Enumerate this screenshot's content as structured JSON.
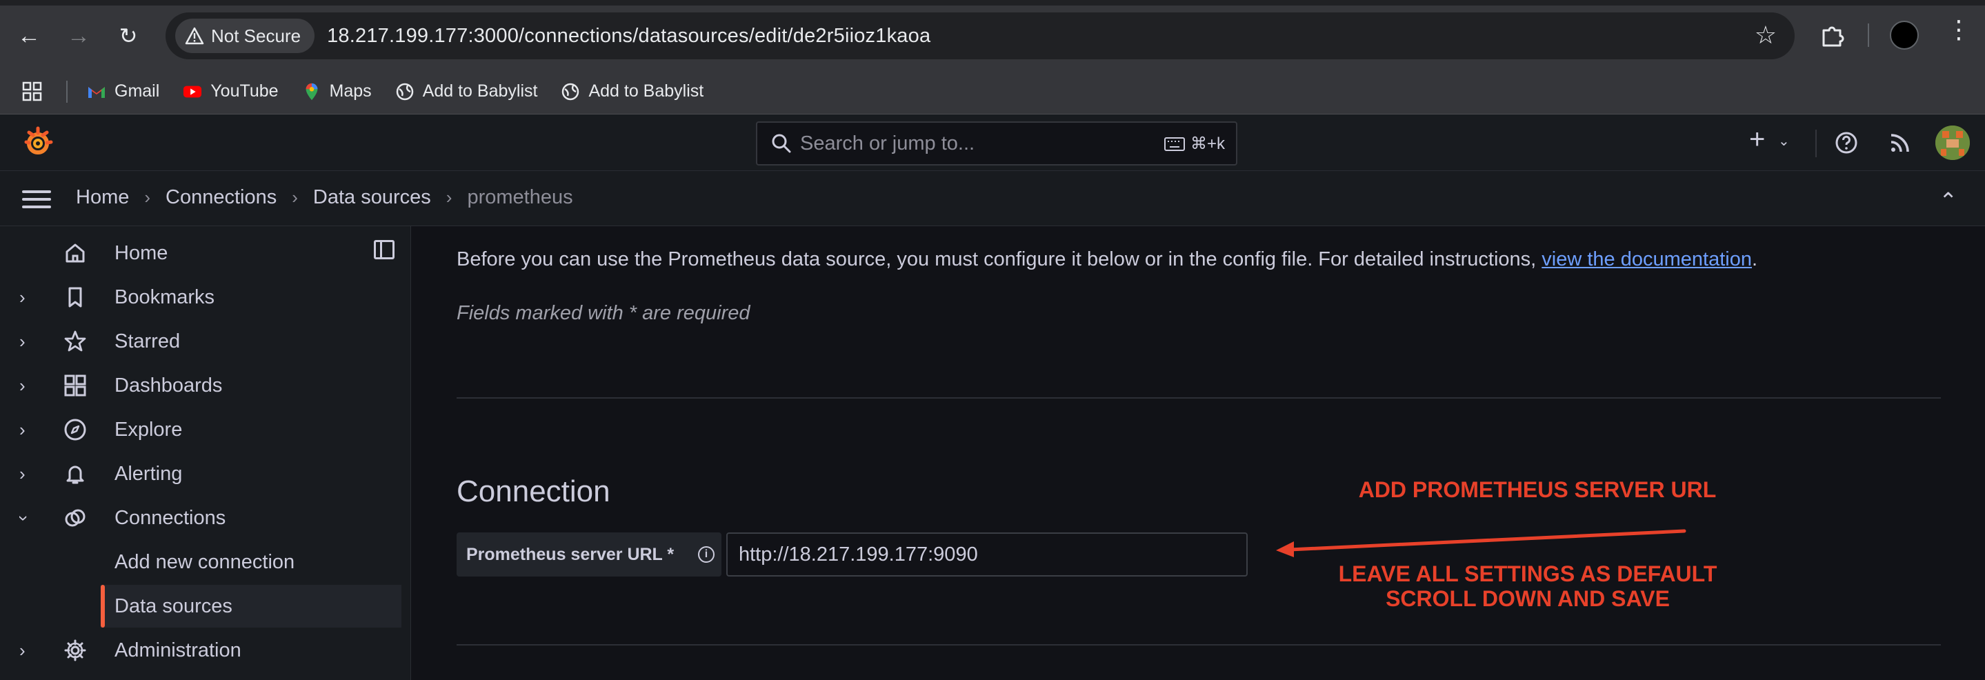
{
  "browser": {
    "security_label": "Not Secure",
    "url": "18.217.199.177:3000/connections/datasources/edit/de2r5iioz1kaoa",
    "bookmarks": [
      {
        "label": "Gmail",
        "icon": "gmail-icon"
      },
      {
        "label": "YouTube",
        "icon": "youtube-icon"
      },
      {
        "label": "Maps",
        "icon": "maps-icon"
      },
      {
        "label": "Add to Babylist",
        "icon": "globe-icon"
      },
      {
        "label": "Add to Babylist",
        "icon": "globe-icon"
      }
    ]
  },
  "topbar": {
    "search_placeholder": "Search or jump to...",
    "search_shortcut": "⌘+k"
  },
  "breadcrumb": [
    "Home",
    "Connections",
    "Data sources",
    "prometheus"
  ],
  "sidebar": {
    "items": [
      {
        "label": "Home",
        "icon": "home-icon",
        "expandable": false
      },
      {
        "label": "Bookmarks",
        "icon": "bookmark-icon",
        "expandable": true
      },
      {
        "label": "Starred",
        "icon": "star-icon",
        "expandable": true
      },
      {
        "label": "Dashboards",
        "icon": "dashboards-icon",
        "expandable": true
      },
      {
        "label": "Explore",
        "icon": "compass-icon",
        "expandable": true
      },
      {
        "label": "Alerting",
        "icon": "bell-icon",
        "expandable": true
      },
      {
        "label": "Connections",
        "icon": "connections-icon",
        "expanded": true
      },
      {
        "label": "Administration",
        "icon": "gear-icon",
        "expandable": true
      }
    ],
    "sub_items": [
      {
        "label": "Add new connection",
        "active": false
      },
      {
        "label": "Data sources",
        "active": true
      }
    ]
  },
  "main": {
    "intro_text": "Before you can use the Prometheus data source, you must configure it below or in the config file. For detailed instructions, ",
    "intro_link": "view the documentation",
    "intro_end": ".",
    "required_note": "Fields marked with * are required",
    "section_title": "Connection",
    "field_label": "Prometheus server URL *",
    "field_value": "http://18.217.199.177:9090"
  },
  "annotations": {
    "line1": "ADD PROMETHEUS SERVER URL",
    "line2": "LEAVE ALL SETTINGS AS DEFAULT",
    "line3": "SCROLL DOWN AND SAVE",
    "color": "#e8412a"
  },
  "colors": {
    "accent": "#f55f3e",
    "link": "#6e9fff"
  }
}
